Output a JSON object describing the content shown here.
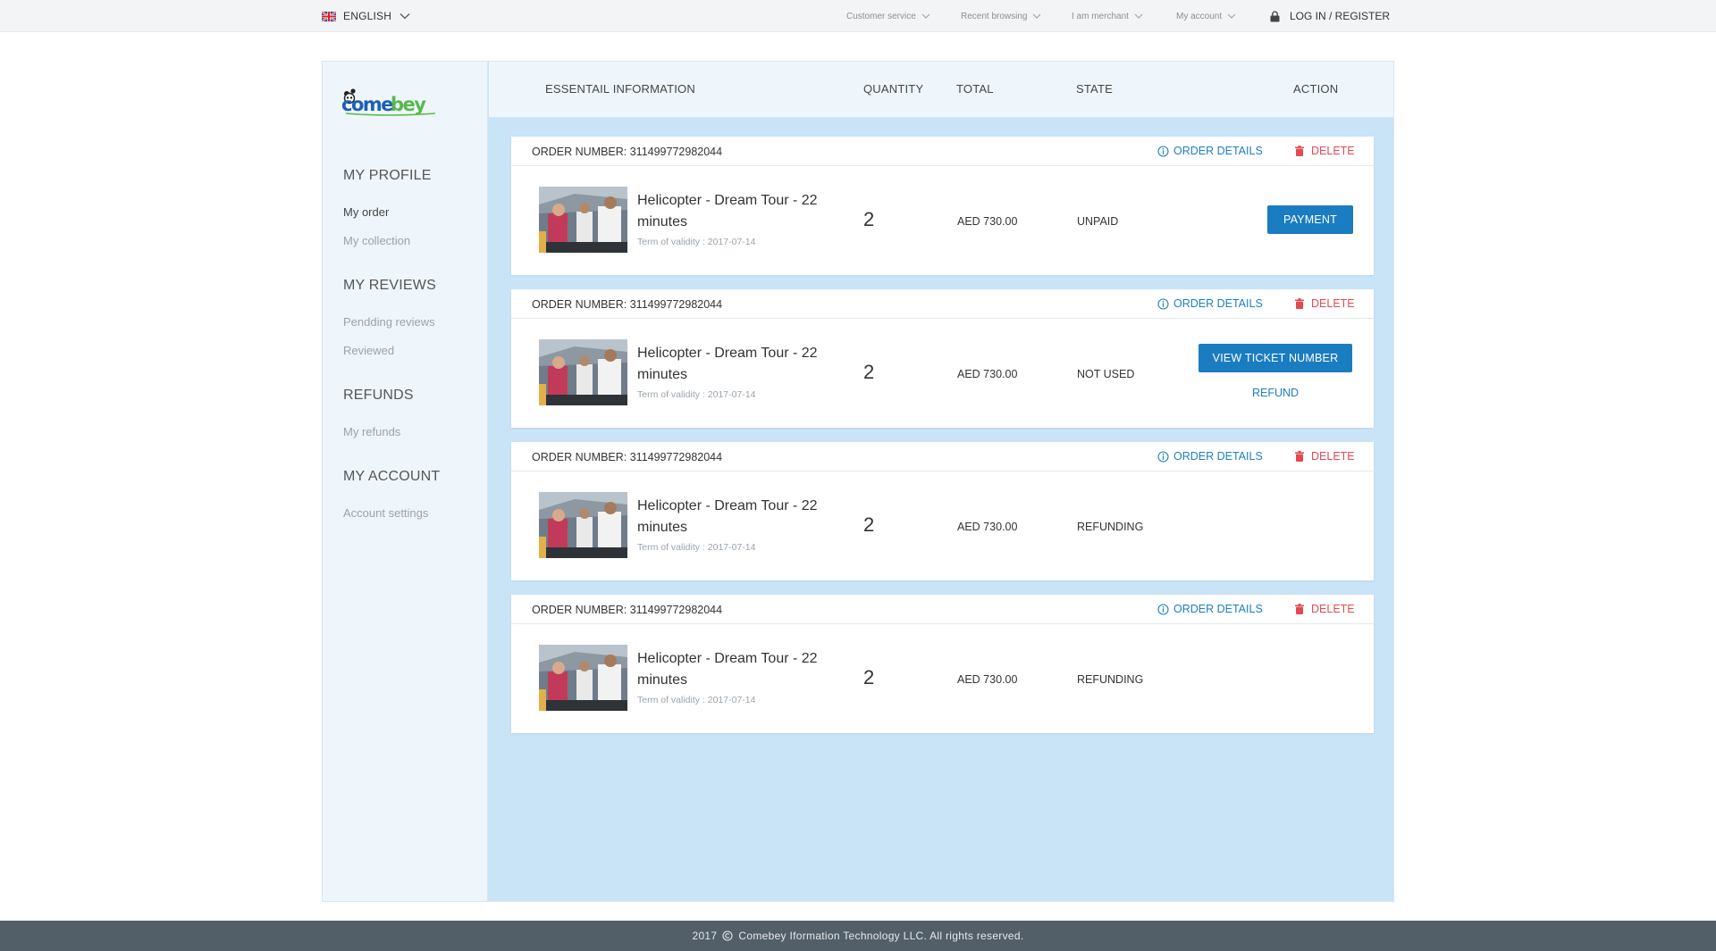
{
  "topbar": {
    "language": "ENGLISH",
    "nav": [
      "Customer service",
      "Recent browsing",
      "I am merchant",
      "My account"
    ],
    "login": "LOG IN / REGISTER"
  },
  "brand": {
    "name": "Comebey"
  },
  "sidebar": {
    "sections": [
      {
        "title": "MY PROFILE",
        "links": [
          "My order",
          "My collection"
        ]
      },
      {
        "title": "MY REVIEWS",
        "links": [
          "Pendding reviews",
          "Reviewed"
        ]
      },
      {
        "title": "REFUNDS",
        "links": [
          "My refunds"
        ]
      },
      {
        "title": "MY ACCOUNT",
        "links": [
          "Account settings"
        ]
      }
    ],
    "active": "My order"
  },
  "table_header": {
    "essential": "ESSENTAIL INFORMATION",
    "quantity": "QUANTITY",
    "total": "TOTAL",
    "state": "STATE",
    "action": "ACTION"
  },
  "labels": {
    "order_details": "ORDER DETAILS",
    "delete": "DELETE"
  },
  "orders": [
    {
      "order_number": "ORDER NUMBER: 311499772982044",
      "product": "Helicopter - Dream Tour - 22 minutes",
      "validity": "Term of validity :   2017-07-14",
      "quantity": "2",
      "total": "AED 730.00",
      "state": "UNPAID",
      "action": "PAYMENT",
      "secondary_action": ""
    },
    {
      "order_number": "ORDER NUMBER: 311499772982044",
      "product": "Helicopter - Dream Tour - 22 minutes",
      "validity": "Term of validity :   2017-07-14",
      "quantity": "2",
      "total": "AED 730.00",
      "state": "NOT USED",
      "action": "VIEW TICKET NUMBER",
      "secondary_action": "REFUND"
    },
    {
      "order_number": "ORDER NUMBER: 311499772982044",
      "product": "Helicopter - Dream Tour - 22 minutes",
      "validity": "Term of validity :   2017-07-14",
      "quantity": "2",
      "total": "AED 730.00",
      "state": "REFUNDING",
      "action": "",
      "secondary_action": ""
    },
    {
      "order_number": "ORDER NUMBER: 311499772982044",
      "product": "Helicopter - Dream Tour - 22 minutes",
      "validity": "Term of validity :   2017-07-14",
      "quantity": "2",
      "total": "AED 730.00",
      "state": "REFUNDING",
      "action": "",
      "secondary_action": ""
    }
  ],
  "footer": {
    "year": "2017",
    "text": "Comebey Iformation Technology LLC. All rights reserved."
  },
  "colors": {
    "accent": "#1a7cc1",
    "danger": "#e24a52",
    "content_bg": "#c9e3f7",
    "footer_bg": "#525f69"
  },
  "icons": [
    "uk-flag-icon",
    "chevron-down-icon",
    "lock-icon",
    "info-icon",
    "trash-icon",
    "copyright-icon"
  ]
}
